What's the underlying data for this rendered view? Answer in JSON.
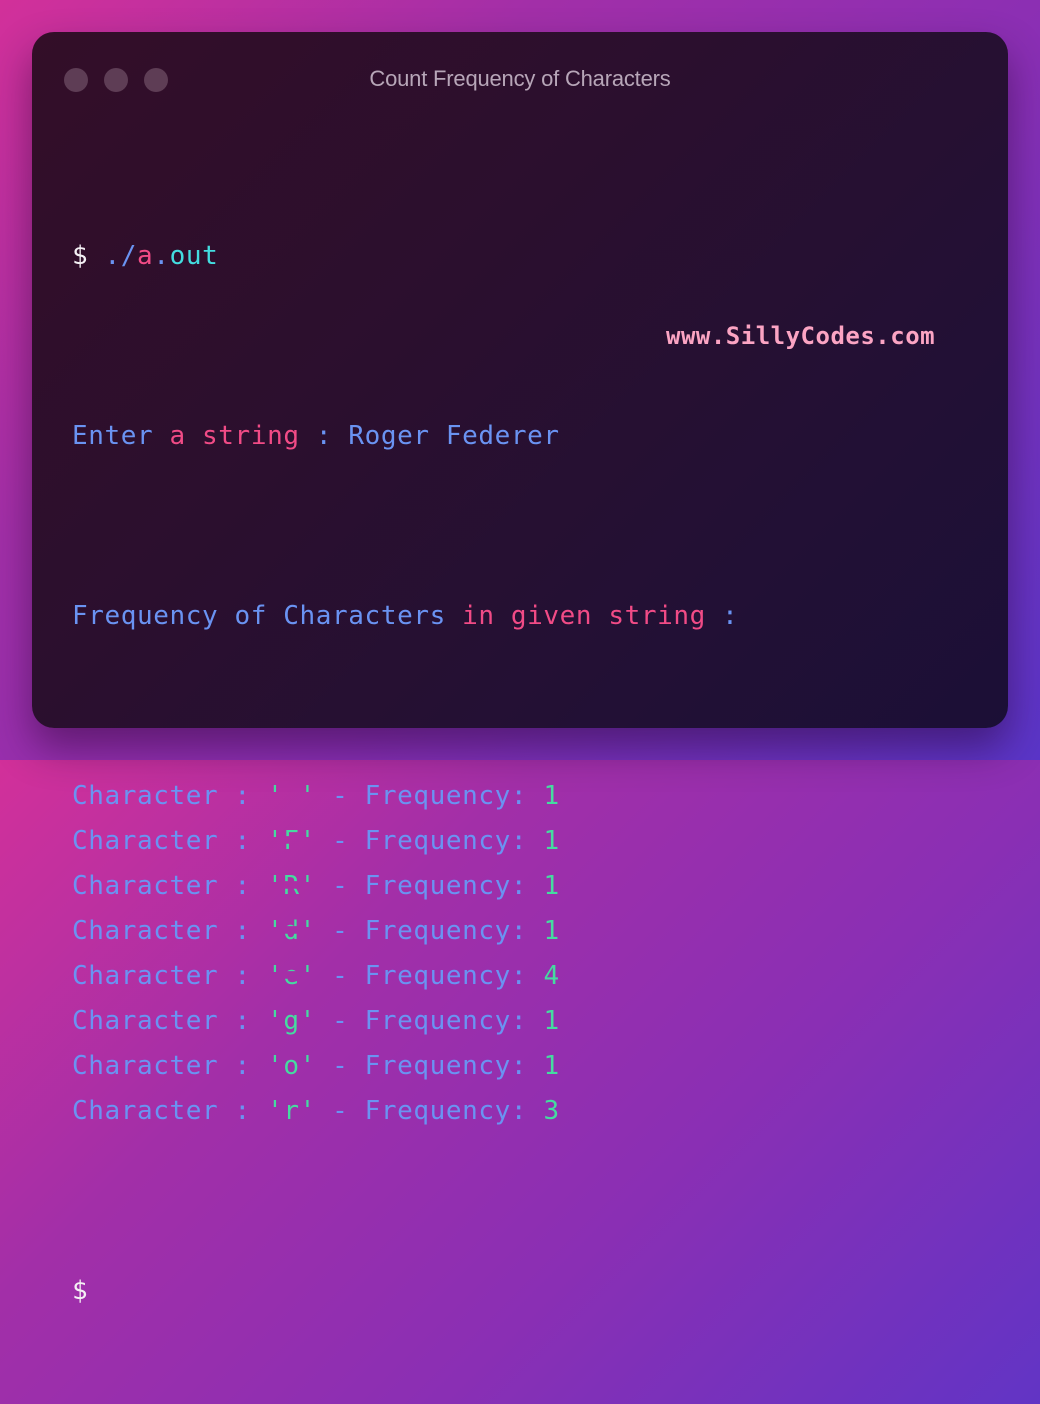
{
  "window": {
    "title": "Count Frequency of Characters",
    "controls": [
      "close",
      "minimize",
      "maximize"
    ]
  },
  "terminal": {
    "command": {
      "prompt": "$",
      "path_prefix": "./",
      "path_mid": "a",
      "path_dot": ".",
      "path_ext": "out"
    },
    "input_line": {
      "label_1": "Enter",
      "label_2": "a string",
      "label_3": ":",
      "value": "Roger Federer"
    },
    "header_line": {
      "part_1": "Frequency of Characters",
      "part_2": "in given string",
      "part_3": ":"
    },
    "rows": [
      {
        "label": "Character :",
        "char": " ",
        "sep": "- Frequency:",
        "count": "1"
      },
      {
        "label": "Character :",
        "char": "F",
        "sep": "- Frequency:",
        "count": "1"
      },
      {
        "label": "Character :",
        "char": "R",
        "sep": "- Frequency:",
        "count": "1"
      },
      {
        "label": "Character :",
        "char": "d",
        "sep": "- Frequency:",
        "count": "1"
      },
      {
        "label": "Character :",
        "char": "e",
        "sep": "- Frequency:",
        "count": "4"
      },
      {
        "label": "Character :",
        "char": "g",
        "sep": "- Frequency:",
        "count": "1"
      },
      {
        "label": "Character :",
        "char": "o",
        "sep": "- Frequency:",
        "count": "1"
      },
      {
        "label": "Character :",
        "char": "r",
        "sep": "- Frequency:",
        "count": "3"
      }
    ],
    "final_prompt": "$"
  },
  "watermark": "www.SillyCodes.com",
  "colors": {
    "text_blue": "#6a93f2",
    "text_pink": "#f14b86",
    "text_cyan": "#43dde0",
    "text_green": "#45dba0",
    "watermark": "#fba4c3"
  }
}
